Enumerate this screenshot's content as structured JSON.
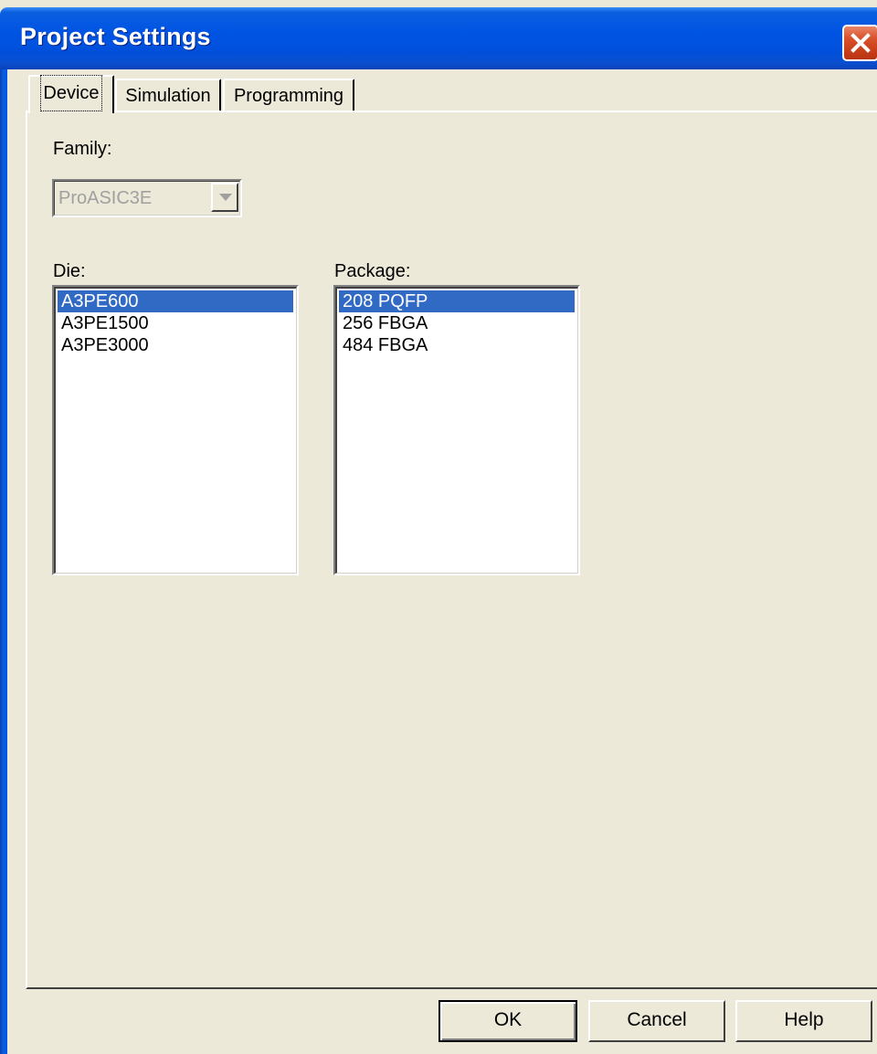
{
  "window": {
    "title": "Project Settings"
  },
  "tabs": [
    {
      "label": "Device",
      "active": true
    },
    {
      "label": "Simulation",
      "active": false
    },
    {
      "label": "Programming",
      "active": false
    }
  ],
  "family": {
    "label": "Family:",
    "value": "ProASIC3E",
    "disabled": true
  },
  "die": {
    "label": "Die:",
    "items": [
      "A3PE600",
      "A3PE1500",
      "A3PE3000"
    ],
    "selected": "A3PE600"
  },
  "package": {
    "label": "Package:",
    "items": [
      "208 PQFP",
      "256 FBGA",
      "484 FBGA"
    ],
    "selected": "208 PQFP"
  },
  "buttons": {
    "ok": "OK",
    "cancel": "Cancel",
    "help": "Help"
  },
  "colors": {
    "titlebar": "#0054e3",
    "selection": "#316ac5",
    "dialog_bg": "#ece9d8",
    "close": "#d9532c"
  },
  "icons": {
    "close": "close-icon",
    "dropdown": "chevron-down-icon"
  }
}
